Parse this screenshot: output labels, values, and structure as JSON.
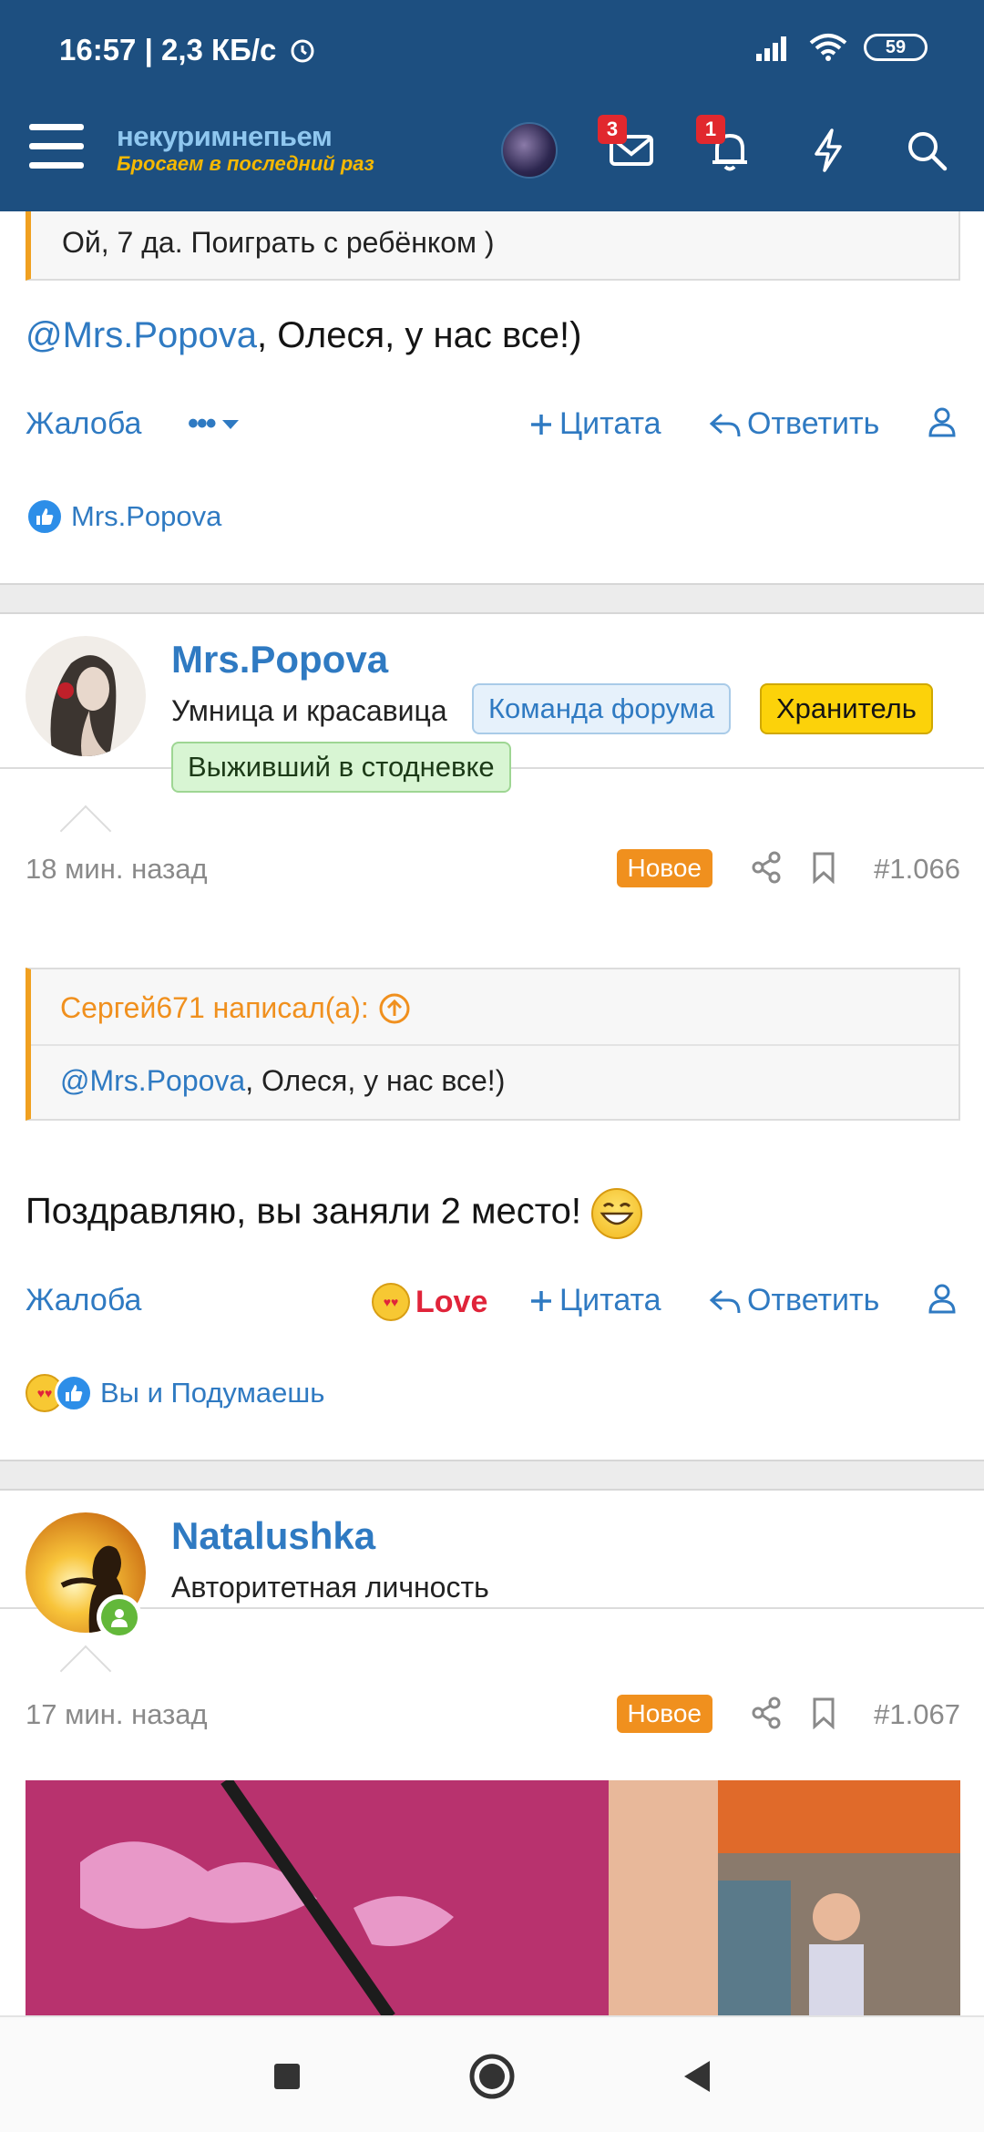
{
  "status_bar": {
    "time": "16:57",
    "speed": "2,3 КБ/с",
    "battery": "59"
  },
  "header": {
    "logo_top": "некуримнепьем",
    "logo_bottom": "Бросаем в последний раз",
    "messages_badge": "3",
    "alerts_badge": "1",
    "icons": [
      "menu-icon",
      "avatar",
      "envelope-icon",
      "bell-icon",
      "lightning-icon",
      "search-icon"
    ]
  },
  "prev_post": {
    "quote_text": "Ой, 7 да. Поиграть с ребёнком )",
    "mention": "@Mrs.Popova",
    "message_rest": ", Олеся, у нас все!)",
    "actions": {
      "report": "Жалоба",
      "more": "•••",
      "quote": "Цитата",
      "reply": "Ответить"
    },
    "reactions_text": "Mrs.Popova"
  },
  "post1066": {
    "username": "Mrs.Popova",
    "user_title": "Умница и красавица",
    "tags": [
      "Команда форума",
      "Хранитель",
      "Выживший в стодневке"
    ],
    "time": "18 мин. назад",
    "new_label": "Новое",
    "number": "#1.066",
    "quote_author": "Сергей671 написал(а):",
    "quote_mention": "@Mrs.Popova",
    "quote_rest": ", Олеся, у нас все!)",
    "message": "Поздравляю, вы заняли 2 место!",
    "actions": {
      "report": "Жалоба",
      "love": "Love",
      "quote": "Цитата",
      "reply": "Ответить"
    },
    "reactions_text": "Вы и Подумаешь"
  },
  "post1067": {
    "username": "Natalushka",
    "user_title": "Авторитетная личность",
    "time": "17 мин. назад",
    "new_label": "Новое",
    "number": "#1.067"
  },
  "colors": {
    "header_bg": "#1d4f80",
    "link": "#2f7ac2",
    "quote_accent": "#f0a020",
    "new_badge": "#f0901e",
    "love": "#e0243a"
  }
}
